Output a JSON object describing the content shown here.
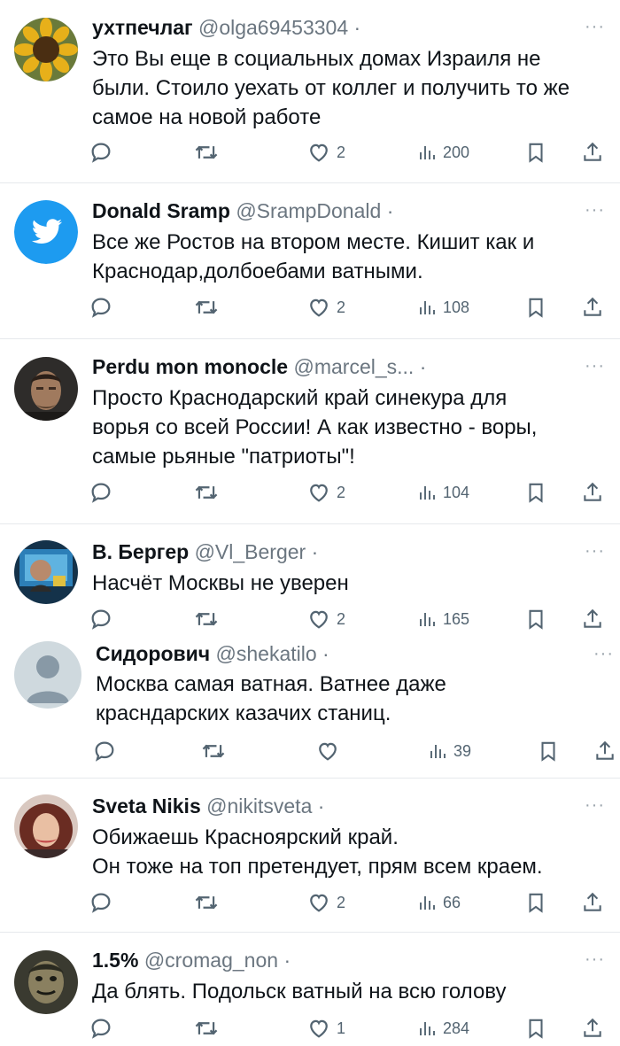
{
  "tweets": [
    {
      "name": "ухтпечлаг",
      "handle": "@olga69453304",
      "dot": "·",
      "lines": [
        "Это Вы еще в социальных домах Израиля не",
        "были. Стоило уехать от коллег и получить то же",
        "самое на новой работе"
      ],
      "likes": "2",
      "views": "200",
      "avatar_icon": "sunflower-avatar"
    },
    {
      "name": "Donald Sramp",
      "handle": "@SrampDonald",
      "dot": "·",
      "lines": [
        "Все же Ростов на втором месте. Кишит как и",
        "Краснодар,долбоебами ватными."
      ],
      "likes": "2",
      "views": "108",
      "avatar_icon": "twitter-bird-avatar"
    },
    {
      "name": "Perdu mon monocle",
      "handle": "@marcel_s...",
      "dot": "·",
      "lines": [
        "Просто Краснодарский край синекура для",
        "ворья со всей России! А как известно - воры,",
        "самые рьяные \"патриоты\"!"
      ],
      "likes": "2",
      "views": "104",
      "avatar_icon": "man-portrait-avatar"
    },
    {
      "name": "В. Бергер",
      "handle": "@Vl_Berger",
      "dot": "·",
      "lines": [
        "Насчёт Москвы не уверен"
      ],
      "likes": "2",
      "views": "165",
      "avatar_icon": "photo-avatar"
    },
    {
      "name": "Сидорович",
      "handle": "@shekatilo",
      "dot": "·",
      "lines": [
        "Москва самая ватная. Ватнее даже",
        "красндарских казачих станиц."
      ],
      "likes": "",
      "views": "39",
      "avatar_icon": "default-user-avatar"
    },
    {
      "name": "Sveta Nikis",
      "handle": "@nikitsveta",
      "dot": "·",
      "lines": [
        "Обижаешь Красноярский край.",
        "Он тоже на топ претендует, прям всем краем."
      ],
      "likes": "2",
      "views": "66",
      "avatar_icon": "woman-portrait-avatar"
    },
    {
      "name": "1.5%",
      "handle": "@cromag_non",
      "dot": "·",
      "lines": [
        "Да блять. Подольск ватный на всю голову"
      ],
      "likes": "1",
      "views": "284",
      "avatar_icon": "mask-portrait-avatar"
    }
  ],
  "more_label": "···",
  "colors": {
    "text": "#0f1419",
    "muted": "#536471",
    "twitter_blue": "#1d9bf0",
    "separator": "#e6e9ec"
  }
}
